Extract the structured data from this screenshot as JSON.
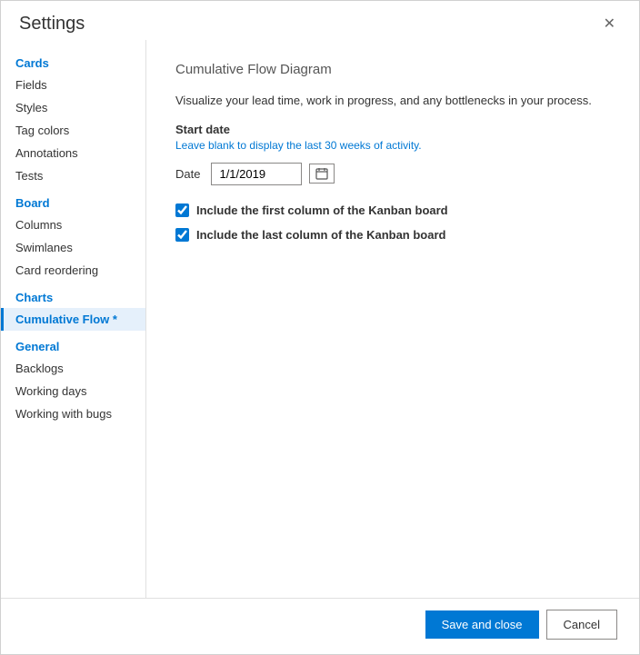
{
  "dialog": {
    "title": "Settings",
    "close_label": "✕"
  },
  "sidebar": {
    "sections": [
      {
        "label": "Cards",
        "items": [
          "Fields",
          "Styles",
          "Tag colors",
          "Annotations",
          "Tests"
        ]
      },
      {
        "label": "Board",
        "items": [
          "Columns",
          "Swimlanes",
          "Card reordering"
        ]
      },
      {
        "label": "Charts",
        "items": [
          "Cumulative Flow *"
        ]
      },
      {
        "label": "General",
        "items": [
          "Backlogs",
          "Working days",
          "Working with bugs"
        ]
      }
    ]
  },
  "main": {
    "section_title": "Cumulative Flow Diagram",
    "description_part1": "Visualize your lead time, work in progress, and any bottlenecks in your process.",
    "start_date_label": "Start date",
    "start_date_hint": "Leave blank to display the last 30 weeks of activity.",
    "date_field_label": "Date",
    "date_value": "1/1/2019",
    "date_placeholder": "1/1/2019",
    "checkbox1_label": "Include the first column of the Kanban board",
    "checkbox2_label": "Include the last column of the Kanban board"
  },
  "footer": {
    "save_label": "Save and close",
    "cancel_label": "Cancel"
  }
}
